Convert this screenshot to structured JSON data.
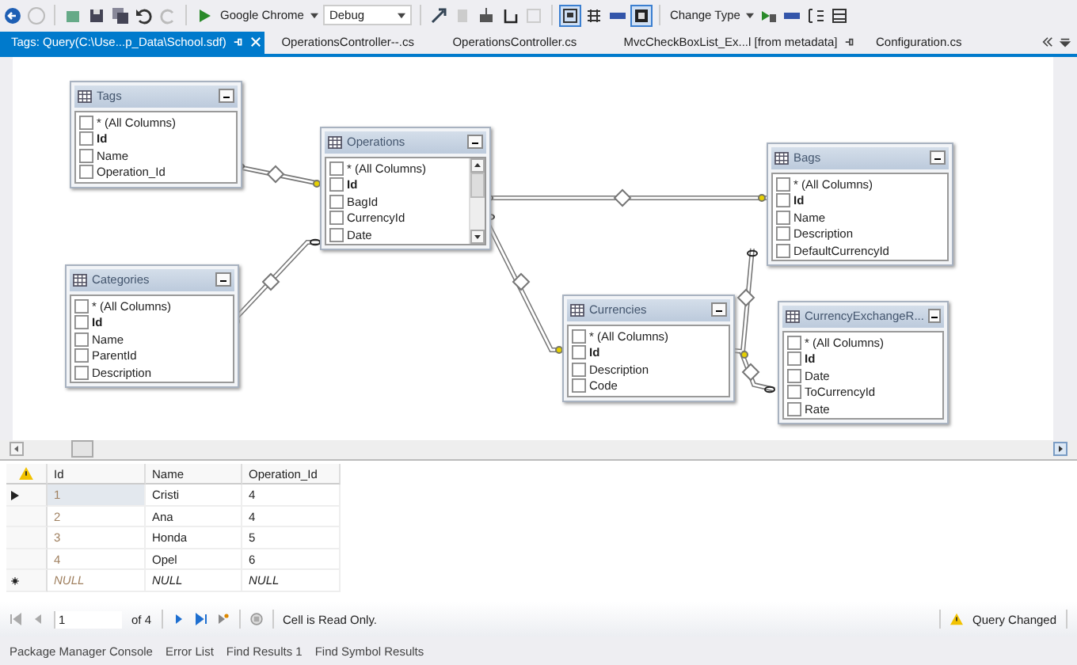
{
  "toolbar": {
    "browser": "Google Chrome",
    "configuration": "Debug",
    "change_type": "Change Type"
  },
  "tabs": [
    {
      "label": "Tags: Query(C:\\Use...p_Data\\School.sdf)",
      "selected": true,
      "pinned": true
    },
    {
      "label": "OperationsController--.cs",
      "selected": false,
      "pinned": false
    },
    {
      "label": "OperationsController.cs",
      "selected": false,
      "pinned": false
    },
    {
      "label": "MvcCheckBoxList_Ex...l [from metadata]",
      "selected": false,
      "pinned": true
    },
    {
      "label": "Configuration.cs",
      "selected": false,
      "pinned": false
    }
  ],
  "diagram": {
    "tables": [
      {
        "title": "Tags",
        "scrollable": false,
        "columns": [
          {
            "name": "* (All Columns)",
            "key": false,
            "checked": false
          },
          {
            "name": "Id",
            "key": true,
            "checked": false
          },
          {
            "name": "Name",
            "key": false,
            "checked": false
          },
          {
            "name": "Operation_Id",
            "key": false,
            "checked": false
          }
        ]
      },
      {
        "title": "Operations",
        "scrollable": true,
        "columns": [
          {
            "name": "* (All Columns)",
            "key": false,
            "checked": false
          },
          {
            "name": "Id",
            "key": true,
            "checked": false
          },
          {
            "name": "BagId",
            "key": false,
            "checked": false
          },
          {
            "name": "CurrencyId",
            "key": false,
            "checked": false
          },
          {
            "name": "Date",
            "key": false,
            "checked": false
          }
        ]
      },
      {
        "title": "Categories",
        "scrollable": false,
        "columns": [
          {
            "name": "* (All Columns)",
            "key": false,
            "checked": false
          },
          {
            "name": "Id",
            "key": true,
            "checked": false
          },
          {
            "name": "Name",
            "key": false,
            "checked": false
          },
          {
            "name": "ParentId",
            "key": false,
            "checked": false
          },
          {
            "name": "Description",
            "key": false,
            "checked": false
          }
        ]
      },
      {
        "title": "Bags",
        "scrollable": false,
        "columns": [
          {
            "name": "* (All Columns)",
            "key": false,
            "checked": false
          },
          {
            "name": "Id",
            "key": true,
            "checked": false
          },
          {
            "name": "Name",
            "key": false,
            "checked": false
          },
          {
            "name": "Description",
            "key": false,
            "checked": false
          },
          {
            "name": "DefaultCurrencyId",
            "key": false,
            "checked": false
          }
        ]
      },
      {
        "title": "Currencies",
        "scrollable": false,
        "columns": [
          {
            "name": "* (All Columns)",
            "key": false,
            "checked": false
          },
          {
            "name": "Id",
            "key": true,
            "checked": false
          },
          {
            "name": "Description",
            "key": false,
            "checked": false
          },
          {
            "name": "Code",
            "key": false,
            "checked": false
          }
        ]
      },
      {
        "title": "CurrencyExchangeR...",
        "scrollable": false,
        "columns": [
          {
            "name": "* (All Columns)",
            "key": false,
            "checked": false
          },
          {
            "name": "Id",
            "key": true,
            "checked": false
          },
          {
            "name": "Date",
            "key": false,
            "checked": false
          },
          {
            "name": "ToCurrencyId",
            "key": false,
            "checked": false
          },
          {
            "name": "Rate",
            "key": false,
            "checked": false
          }
        ]
      }
    ]
  },
  "results": {
    "columns": [
      "Id",
      "Name",
      "Operation_Id"
    ],
    "rows": [
      {
        "kind": "data",
        "selected": true,
        "cells": [
          "1",
          "Cristi",
          "4"
        ]
      },
      {
        "kind": "data",
        "selected": false,
        "cells": [
          "2",
          "Ana",
          "4"
        ]
      },
      {
        "kind": "data",
        "selected": false,
        "cells": [
          "3",
          "Honda",
          "5"
        ]
      },
      {
        "kind": "data",
        "selected": false,
        "cells": [
          "4",
          "Opel",
          "6"
        ]
      },
      {
        "kind": "new",
        "selected": false,
        "cells": [
          "NULL",
          "NULL",
          "NULL"
        ]
      }
    ]
  },
  "navigator": {
    "record": "1",
    "of": "of 4",
    "status": "Cell is Read Only.",
    "query_state": "Query Changed"
  },
  "bottom_tabs": [
    "Package Manager Console",
    "Error List",
    "Find Results 1",
    "Find Symbol Results"
  ]
}
